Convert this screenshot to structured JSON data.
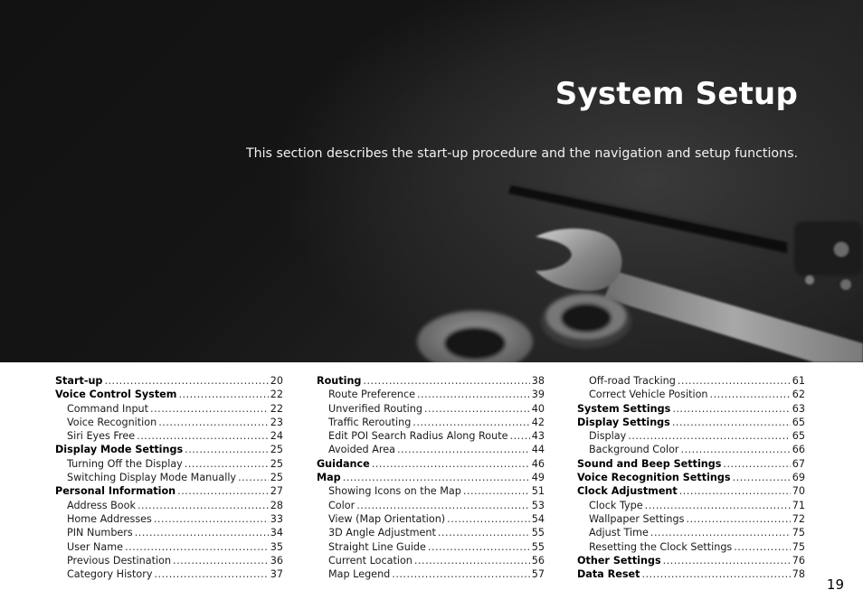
{
  "hero": {
    "title": "System Setup",
    "subtitle": "This section describes the start-up procedure and the navigation and setup functions.",
    "image": "wrench-screwdriver-washer-nut-photo"
  },
  "toc": {
    "columns": [
      [
        {
          "label": "Start-up",
          "page": "20",
          "level": "main"
        },
        {
          "label": "Voice Control System",
          "page": "22",
          "level": "main"
        },
        {
          "label": "Command Input",
          "page": "22",
          "level": "sub"
        },
        {
          "label": "Voice Recognition",
          "page": "23",
          "level": "sub"
        },
        {
          "label": "Siri Eyes Free",
          "page": "24",
          "level": "sub"
        },
        {
          "label": "Display Mode Settings",
          "page": "25",
          "level": "main"
        },
        {
          "label": "Turning Off the Display",
          "page": "25",
          "level": "sub"
        },
        {
          "label": "Switching Display Mode Manually",
          "page": "25",
          "level": "sub"
        },
        {
          "label": "Personal Information",
          "page": "27",
          "level": "main"
        },
        {
          "label": "Address Book",
          "page": "28",
          "level": "sub"
        },
        {
          "label": "Home Addresses",
          "page": "33",
          "level": "sub"
        },
        {
          "label": "PIN Numbers",
          "page": "34",
          "level": "sub"
        },
        {
          "label": "User Name",
          "page": "35",
          "level": "sub"
        },
        {
          "label": "Previous Destination",
          "page": "36",
          "level": "sub"
        },
        {
          "label": "Category History",
          "page": "37",
          "level": "sub"
        }
      ],
      [
        {
          "label": "Routing",
          "page": "38",
          "level": "main"
        },
        {
          "label": "Route Preference",
          "page": "39",
          "level": "sub"
        },
        {
          "label": "Unverified Routing",
          "page": "40",
          "level": "sub"
        },
        {
          "label": "Traffic Rerouting",
          "page": "42",
          "level": "sub"
        },
        {
          "label": "Edit POI Search Radius Along Route",
          "page": "43",
          "level": "sub"
        },
        {
          "label": "Avoided Area",
          "page": "44",
          "level": "sub"
        },
        {
          "label": "Guidance",
          "page": "46",
          "level": "main"
        },
        {
          "label": "Map",
          "page": "49",
          "level": "main"
        },
        {
          "label": "Showing Icons on the Map",
          "page": "51",
          "level": "sub"
        },
        {
          "label": "Color",
          "page": "53",
          "level": "sub"
        },
        {
          "label": "View (Map Orientation)",
          "page": "54",
          "level": "sub"
        },
        {
          "label": "3D Angle Adjustment",
          "page": "55",
          "level": "sub"
        },
        {
          "label": "Straight Line Guide",
          "page": "55",
          "level": "sub"
        },
        {
          "label": "Current Location",
          "page": "56",
          "level": "sub"
        },
        {
          "label": "Map Legend",
          "page": "57",
          "level": "sub"
        }
      ],
      [
        {
          "label": "Off-road Tracking",
          "page": "61",
          "level": "sub"
        },
        {
          "label": "Correct Vehicle Position",
          "page": "62",
          "level": "sub"
        },
        {
          "label": "System Settings",
          "page": "63",
          "level": "main"
        },
        {
          "label": "Display Settings",
          "page": "65",
          "level": "main"
        },
        {
          "label": "Display",
          "page": "65",
          "level": "sub"
        },
        {
          "label": "Background Color",
          "page": "66",
          "level": "sub"
        },
        {
          "label": "Sound and Beep Settings",
          "page": "67",
          "level": "main"
        },
        {
          "label": "Voice Recognition Settings",
          "page": "69",
          "level": "main"
        },
        {
          "label": "Clock Adjustment",
          "page": "70",
          "level": "main"
        },
        {
          "label": "Clock Type",
          "page": "71",
          "level": "sub"
        },
        {
          "label": "Wallpaper Settings",
          "page": "72",
          "level": "sub"
        },
        {
          "label": "Adjust Time",
          "page": "75",
          "level": "sub"
        },
        {
          "label": "Resetting the Clock Settings",
          "page": "75",
          "level": "sub"
        },
        {
          "label": "Other Settings",
          "page": "76",
          "level": "main"
        },
        {
          "label": "Data Reset",
          "page": "78",
          "level": "main"
        }
      ]
    ]
  },
  "page_number": "19"
}
